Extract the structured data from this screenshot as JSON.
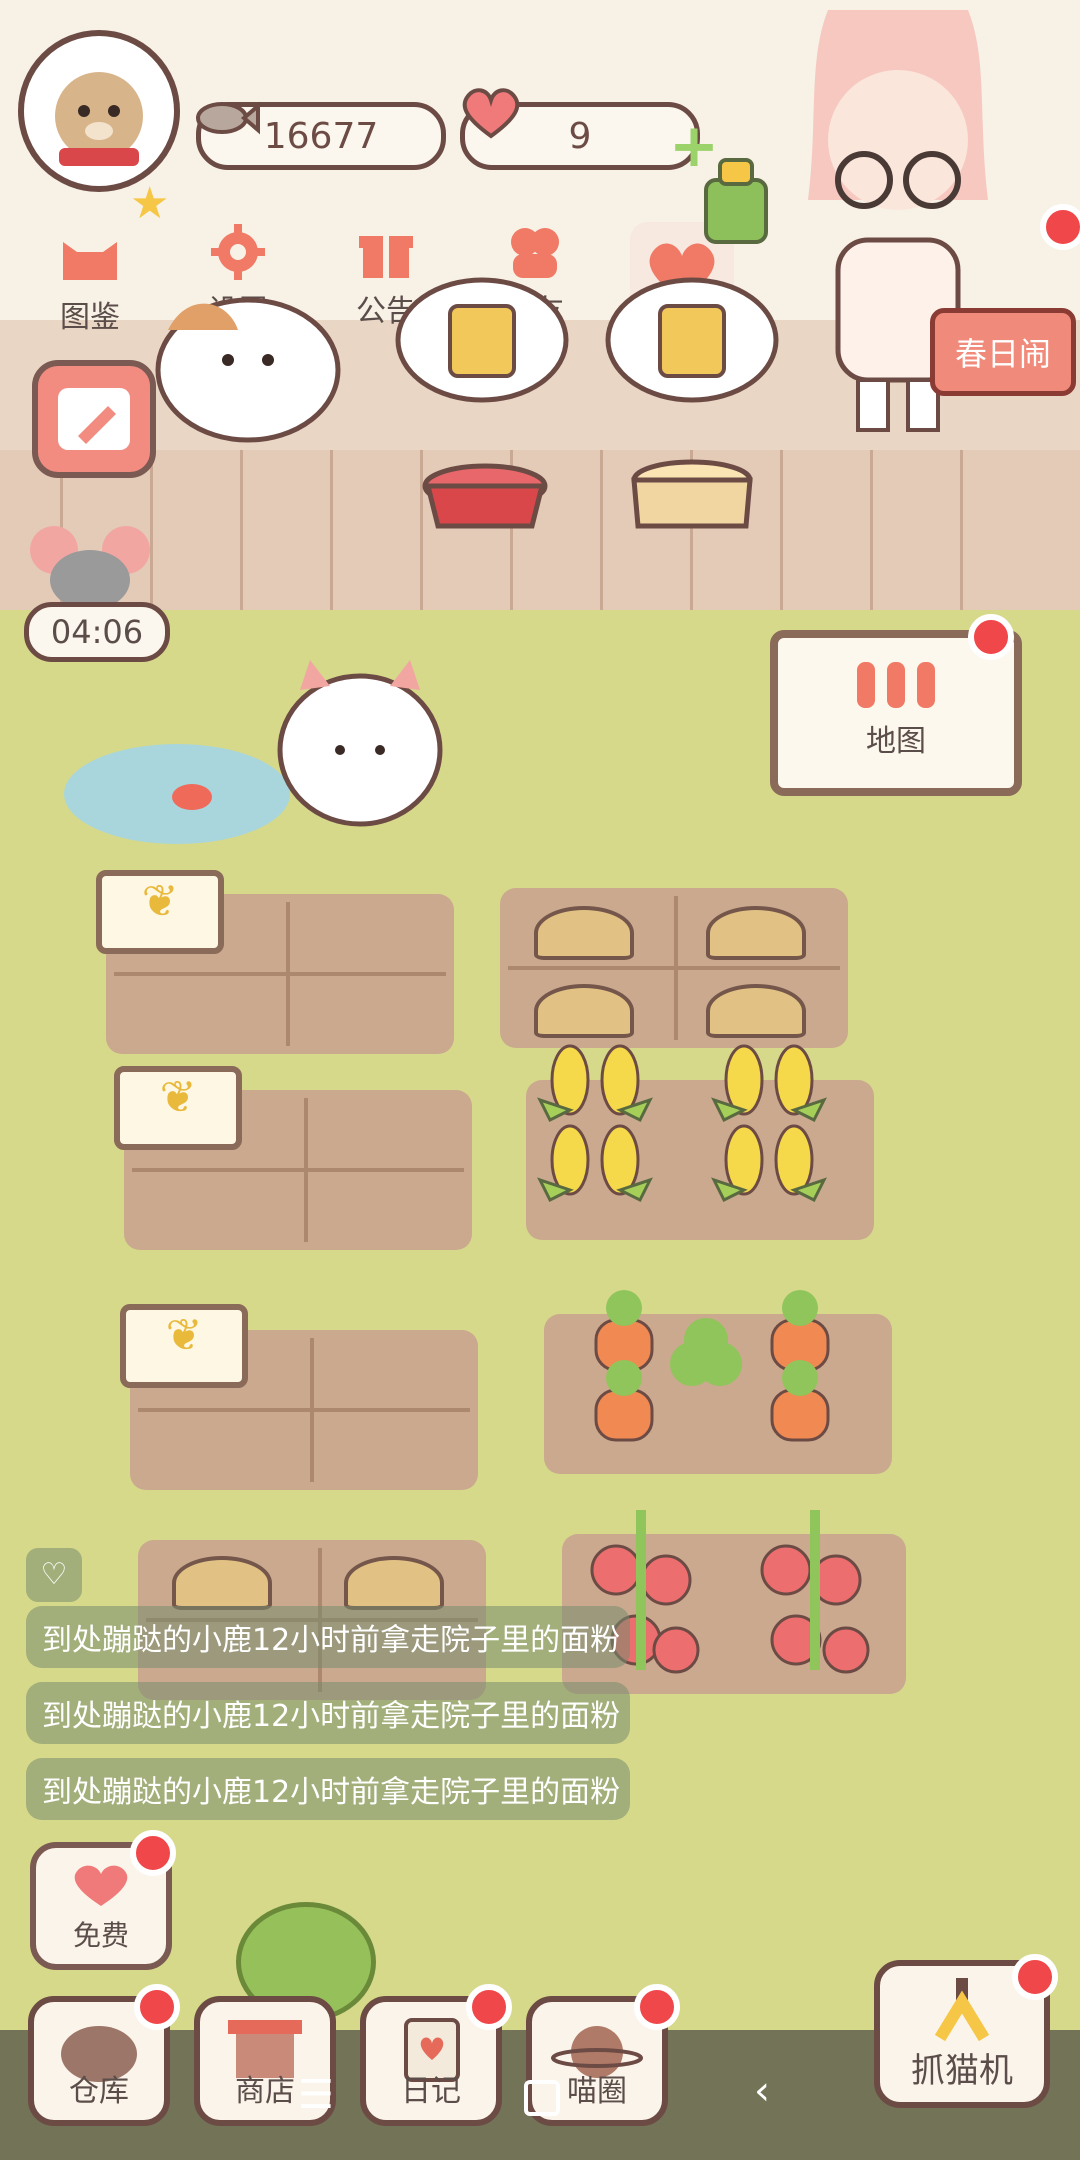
{
  "currencies": {
    "fish": "16677",
    "hearts": "9"
  },
  "menu": [
    {
      "label": "图鉴",
      "icon": "cat-head-icon"
    },
    {
      "label": "设置",
      "icon": "gear-icon"
    },
    {
      "label": "公告",
      "icon": "gift-icon"
    },
    {
      "label": "好友",
      "icon": "friends-icon"
    }
  ],
  "event_button": {
    "label": "春日闹"
  },
  "timer": {
    "value": "04:06"
  },
  "map_sign": {
    "label": "地图"
  },
  "messages": [
    "到处蹦跶的小鹿12小时前拿走院子里的面粉",
    "到处蹦跶的小鹿12小时前拿走院子里的面粉",
    "到处蹦跶的小鹿12小时前拿走院子里的面粉"
  ],
  "free_button": {
    "label": "免费"
  },
  "bottom_nav": [
    {
      "label": "仓库"
    },
    {
      "label": "商店"
    },
    {
      "label": "日记"
    },
    {
      "label": "喵圈"
    },
    {
      "label": "抓猫机"
    }
  ],
  "colors": {
    "grass": "#d6d98a",
    "soil": "#c9a58f",
    "accent_red": "#f0474a",
    "border_brown": "#6d4b45"
  }
}
